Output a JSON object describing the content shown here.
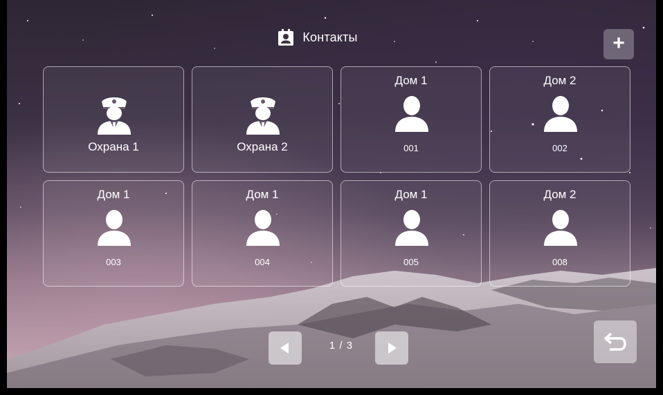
{
  "header": {
    "title": "Контакты",
    "icon": "contacts-icon"
  },
  "add_button": {
    "label": "+",
    "icon": "plus-icon"
  },
  "tiles": [
    {
      "top": "",
      "icon": "guard-icon",
      "bottom": "Охрана 1",
      "kind": "guard"
    },
    {
      "top": "",
      "icon": "guard-icon",
      "bottom": "Охрана 2",
      "kind": "guard"
    },
    {
      "top": "Дом 1",
      "icon": "person-icon",
      "bottom": "001",
      "kind": "person"
    },
    {
      "top": "Дом 2",
      "icon": "person-icon",
      "bottom": "002",
      "kind": "person"
    },
    {
      "top": "Дом 1",
      "icon": "person-icon",
      "bottom": "003",
      "kind": "person"
    },
    {
      "top": "Дом 1",
      "icon": "person-icon",
      "bottom": "004",
      "kind": "person"
    },
    {
      "top": "Дом 1",
      "icon": "person-icon",
      "bottom": "005",
      "kind": "person"
    },
    {
      "top": "Дом 2",
      "icon": "person-icon",
      "bottom": "008",
      "kind": "person"
    }
  ],
  "pager": {
    "label": "1 / 3",
    "prev_icon": "arrow-left-icon",
    "next_icon": "arrow-right-icon"
  },
  "back_button": {
    "icon": "return-icon"
  }
}
